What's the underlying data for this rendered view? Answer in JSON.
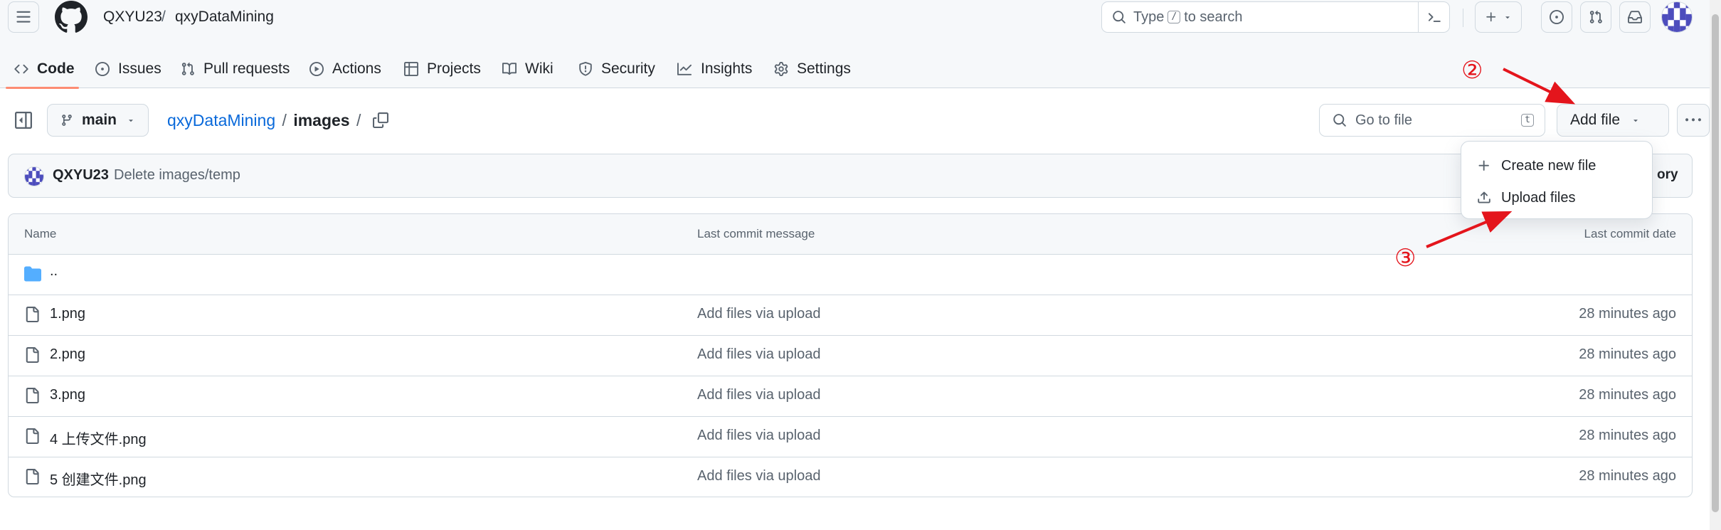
{
  "header": {
    "owner": "QXYU23",
    "separator": "/",
    "repo": "qxyDataMining",
    "search_pre": "Type",
    "search_key": "/",
    "search_post": "to search"
  },
  "tabs": [
    {
      "label": "Code",
      "icon": "code-icon",
      "selected": true
    },
    {
      "label": "Issues",
      "icon": "issue-opened-icon"
    },
    {
      "label": "Pull requests",
      "icon": "git-pull-request-icon"
    },
    {
      "label": "Actions",
      "icon": "play-icon"
    },
    {
      "label": "Projects",
      "icon": "table-icon"
    },
    {
      "label": "Wiki",
      "icon": "book-icon"
    },
    {
      "label": "Security",
      "icon": "shield-icon"
    },
    {
      "label": "Insights",
      "icon": "graph-icon"
    },
    {
      "label": "Settings",
      "icon": "gear-icon"
    }
  ],
  "toolbar": {
    "branch": "main",
    "path_repo": "qxyDataMining",
    "path_sep": "/",
    "path_dir": "images",
    "path_trail": "/",
    "go_to_file_placeholder": "Go to file",
    "go_to_file_key": "t",
    "add_file_label": "Add file"
  },
  "commit": {
    "author": "QXYU23",
    "message": "Delete images/temp",
    "history_partial": "ory"
  },
  "add_file_menu": {
    "items": [
      {
        "label": "Create new file",
        "icon": "plus-icon"
      },
      {
        "label": "Upload files",
        "icon": "upload-icon"
      }
    ]
  },
  "table": {
    "headers": {
      "name": "Name",
      "message": "Last commit message",
      "date": "Last commit date"
    },
    "parent_dir": "..",
    "rows": [
      {
        "name": "1.png",
        "message": "Add files via upload",
        "date": "28 minutes ago"
      },
      {
        "name": "2.png",
        "message": "Add files via upload",
        "date": "28 minutes ago"
      },
      {
        "name": "3.png",
        "message": "Add files via upload",
        "date": "28 minutes ago"
      },
      {
        "name": "4 上传文件.png",
        "message": "Add files via upload",
        "date": "28 minutes ago"
      },
      {
        "name": "5 创建文件.png",
        "message": "Add files via upload",
        "date": "28 minutes ago"
      }
    ]
  },
  "annotations": {
    "step2": "②",
    "step3": "③"
  },
  "colors": {
    "link": "#0969da",
    "underline": "#fd8c73",
    "folder": "#54aeff",
    "annotation": "#e4151c"
  }
}
